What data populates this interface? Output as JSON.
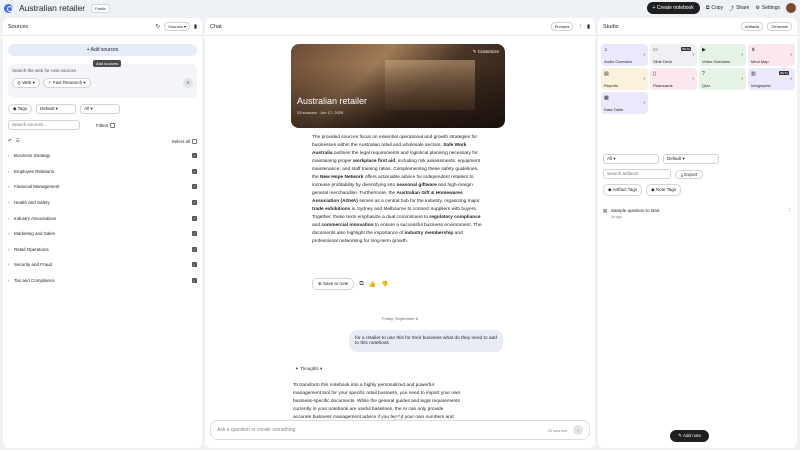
{
  "topbar": {
    "title": "Australian retailer",
    "public_badge": "Public",
    "create_notebook": "+ Create notebook",
    "copy": "Copy",
    "share": "Share",
    "settings": "Settings"
  },
  "sources": {
    "title": "Sources",
    "dropdown": "Sources",
    "add_sources": "+ Add sources",
    "tooltip": "Add sources",
    "web_hint": "Search the web for new sources",
    "web_chip": "Web",
    "research_chip": "Fast Research",
    "tags_label": "Tags",
    "tags_select": "Default",
    "all_select": "All",
    "search_placeholder": "Search sources...",
    "filters_label": "Filters",
    "select_all": "Select all",
    "categories": [
      "Business Strategy",
      "Employee Relations",
      "Financial Management",
      "Health and Safety",
      "Industry Associations",
      "Marketing and Sales",
      "Retail Operations",
      "Security and Fraud",
      "Tax and Compliance"
    ]
  },
  "chat": {
    "title": "Chat",
    "prompts_btn": "Prompts",
    "hero_title": "Australian retailer",
    "hero_sub": "33 sources · Jun 17, 2025",
    "customize": "Customize",
    "summary": {
      "p1": "The provided sources focus on essential operational and growth strategies for businesses within the Australian retail and wholesale sectors.",
      "b1": "Safe Work Australia",
      "p2": "outlines the legal requirements and logistical planning necessary for maintaining proper",
      "b2": "workplace first aid",
      "p3": ", including risk assessments, equipment maintenance, and staff training ratios. Complementing these safety guidelines, the",
      "b3": "New Hope Network",
      "p4": "offers actionable advice for independent retailers to increase profitability by diversifying into",
      "b4": "seasonal giftware",
      "p5": "and high-margin general merchandise. Furthermore, the",
      "b5": "Australian Gift & Homewares Association (AGHA)",
      "p6": "serves as a central hub for the industry, organizing major",
      "b6": "trade exhibitions",
      "p7": "in Sydney and Melbourne to connect suppliers with buyers. Together, these texts emphasize a dual commitment to",
      "b7": "regulatory compliance",
      "p8": "and",
      "b8": "commercial innovation",
      "p9": "to ensure a successful business environment. The documents also highlight the importance of",
      "b9": "industry membership",
      "p10": "and professional networking for long-term growth."
    },
    "save_to_note": "Save to note",
    "date_separator": "Friday, September 6",
    "user_message": "for a retailer to use this for their business what do they need to add to this notebook",
    "thoughts": "Thoughts",
    "reply": "To transform this notebook into a highly personalized and powerful management tool for your specific retail business, you need to import your own business-specific documents. While the general guides and legal requirements currently in your notebook are useful baselines, the AI can only provide accurate business management advice if you feed it your own numbers and context",
    "input_placeholder": "Ask a question or create something",
    "source_count": "33 sources"
  },
  "studio": {
    "title": "Studio",
    "artifacts_btn": "Artifacts",
    "generate_btn": "Generate",
    "tiles": [
      {
        "label": "Audio Overview",
        "color": "purple",
        "badge": ""
      },
      {
        "label": "Slide Deck",
        "color": "gray",
        "badge": "BETA"
      },
      {
        "label": "Video Overview",
        "color": "green",
        "badge": ""
      },
      {
        "label": "Mind Map",
        "color": "pink",
        "badge": ""
      },
      {
        "label": "Reports",
        "color": "yellow",
        "badge": ""
      },
      {
        "label": "Flashcards",
        "color": "pink",
        "badge": ""
      },
      {
        "label": "Quiz",
        "color": "green",
        "badge": ""
      },
      {
        "label": "Infographic",
        "color": "purple",
        "badge": "BETA"
      },
      {
        "label": "Data Table",
        "color": "purple",
        "badge": ""
      }
    ],
    "filter_all": "All",
    "filter_default": "Default",
    "search_placeholder": "Search artifacts",
    "export": "Export",
    "artifact_tags": "Artifact Tags",
    "note_tags": "Note Tags",
    "artifact_title": "Sample question to start",
    "artifact_sub": "4d ago",
    "add_note": "Add note"
  }
}
